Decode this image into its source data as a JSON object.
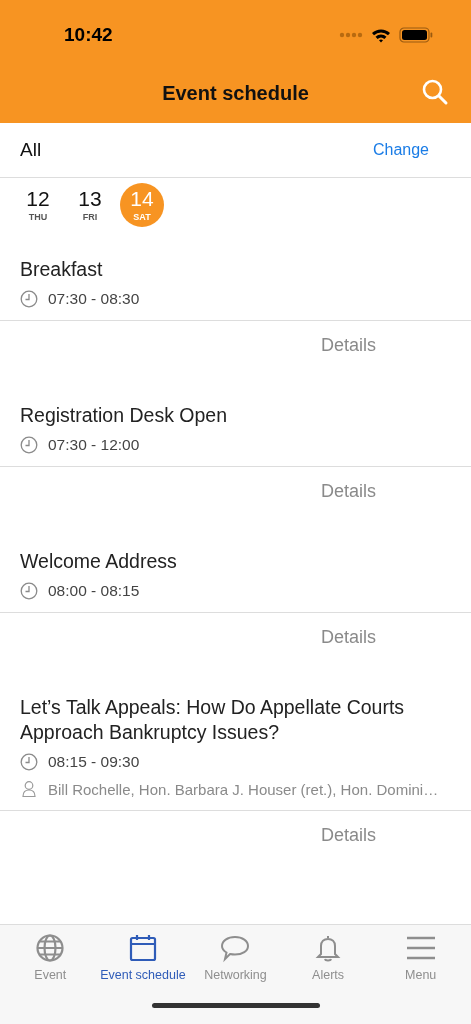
{
  "status_bar": {
    "time": "10:42"
  },
  "header": {
    "title": "Event schedule"
  },
  "filter": {
    "label": "All",
    "action": "Change"
  },
  "days": [
    {
      "day": "12",
      "weekday": "THU",
      "selected": false
    },
    {
      "day": "13",
      "weekday": "FRI",
      "selected": false
    },
    {
      "day": "14",
      "weekday": "SAT",
      "selected": true
    }
  ],
  "sessions": [
    {
      "title": "Breakfast",
      "time": "07:30 - 08:30",
      "details": "Details"
    },
    {
      "title": "Registration Desk Open",
      "time": "07:30 - 12:00",
      "details": "Details"
    },
    {
      "title": "Welcome Address",
      "time": "08:00 - 08:15",
      "details": "Details"
    },
    {
      "title": "Let’s Talk Appeals: How Do Appellate Courts Approach Bankruptcy Issues?",
      "time": "08:15 - 09:30",
      "speakers": "Bill Rochelle, Hon. Barbara J. Houser (ret.), Hon. Domini…",
      "details": "Details"
    }
  ],
  "tab_bar": [
    {
      "kind": "globe",
      "label": "Event",
      "selected": false
    },
    {
      "kind": "calendar",
      "label": "Event schedule",
      "selected": true
    },
    {
      "kind": "chat",
      "label": "Networking",
      "selected": false
    },
    {
      "kind": "bell",
      "label": "Alerts",
      "selected": false
    },
    {
      "kind": "menu",
      "label": "Menu",
      "selected": false
    }
  ]
}
